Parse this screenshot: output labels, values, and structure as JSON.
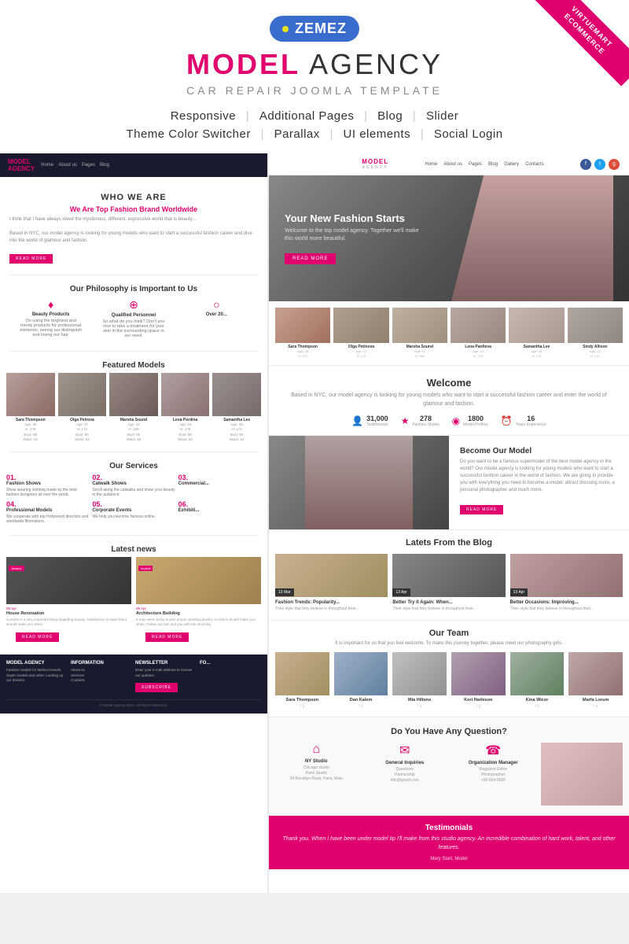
{
  "brand": {
    "logo": "ZEMEZ",
    "logo_dot_color": "#e8e020",
    "logo_bg": "#3a6cce"
  },
  "header": {
    "title_highlight": "MODEL",
    "title_rest": " AGENCY",
    "subtitle": "CAR REPAIR  JOOMLA TEMPLATE"
  },
  "features": {
    "row1": [
      "Responsive",
      "Additional Pages",
      "Blog",
      "Slider"
    ],
    "row2": [
      "Theme Color Switcher",
      "Parallax",
      "UI elements",
      "Social Login"
    ]
  },
  "ribbon": {
    "line1": "VIRTUEMART",
    "line2": "ECOMMERCE"
  },
  "left_panel": {
    "nav": {
      "logo": "MODEL AGENCY",
      "items": [
        "Home",
        "About us",
        "Pages",
        "Blog"
      ]
    },
    "who_we_are": {
      "heading": "WHO WE ARE",
      "subheading": "We Are Top Fashion Brand Worldwide",
      "text": "I think that I have always loved the mysterious, different, expressive world that is beauty...",
      "btn": "READ MORE"
    },
    "philosophy": {
      "title": "Our Philosophy is Important to Us",
      "items": [
        {
          "icon": "♦",
          "label": "Beauty Products",
          "text": "On using the brightest and trendy products for professional elements, seeing our distinguish and loving our hair."
        },
        {
          "icon": "⊕",
          "label": "Qualified Personnel",
          "text": "So what do you think? Don't you nice to take a treatment for your skin in the surrounding space in our need."
        },
        {
          "icon": "○",
          "label": "Over 20...",
          "text": ""
        }
      ]
    },
    "models": {
      "title": "Featured Models",
      "list": [
        {
          "name": "Sara Thompson",
          "details": "Age: 25\nHeight: 170\nBust: 88\nWaist: 61"
        },
        {
          "name": "Olga Petrova",
          "details": "Age: 27\nHeight: 172\nBust: 90\nWaist: 63"
        },
        {
          "name": "Marsha Sound",
          "details": "Age: 22\nHeight: 168\nBust: 86\nWaist: 60"
        },
        {
          "name": "Lena Perdina",
          "details": "Age: 24\nHeight: 170\nBust: 88\nWaist: 62"
        },
        {
          "name": "Samantha Lee",
          "details": "Age: 26\nHeight: 174\nBust: 92\nWaist: 64"
        }
      ]
    },
    "services": {
      "title": "Our Services",
      "list": [
        {
          "num": "01.",
          "name": "Fashion Shows",
          "text": "Show wearing clothing made by the best fashion designers all over the world."
        },
        {
          "num": "02.",
          "name": "Catwalk Shows",
          "text": "Scroll along the catwalks and show your beauty to the audience."
        },
        {
          "num": "03.",
          "name": "Commercial...",
          "text": ""
        },
        {
          "num": "04.",
          "name": "Professional Models",
          "text": "We cooperate with top Hollywood directors and other worldwide famous filmmakers."
        },
        {
          "num": "05.",
          "name": "Corporate Events",
          "text": "We help you become famous online."
        },
        {
          "num": "06.",
          "name": "Exhibiti...",
          "text": ""
        }
      ]
    },
    "news": {
      "title": "Latest news",
      "items": [
        {
          "badge": "Jewelry",
          "date": "05 Apr",
          "headline": "House Renovation",
          "text": "Comfort is a very important thing regarding beauty. Satisfaction is clear..."
        },
        {
          "badge": "Implicit",
          "date": "08 Apr",
          "headline": "Architecture Building",
          "text": "It may seem tricky to pick proper wedding jewelry so that it should make you shine. Follow our tips..."
        }
      ]
    },
    "footer": {
      "cols": [
        {
          "title": "MODEL AGENCY",
          "items": [
            "Fashion models for fashion brands. Super models and other. Looking up our dreams. Designers meet their."
          ]
        },
        {
          "title": "INFORMATION",
          "items": [
            "About us",
            "Services",
            "Contacts"
          ]
        },
        {
          "title": "NEWSLETTER",
          "items": [
            "Enter your e-mail address to receive our updates.",
            "SUBSCRIBE"
          ]
        },
        {
          "title": "FO...",
          "items": []
        }
      ],
      "bottom": "© Model Agency 2016. All Rights Reserved."
    }
  },
  "right_panel": {
    "nav": {
      "logo_main": "MODEL",
      "logo_sub": "AGENCY",
      "items": [
        "Home",
        "About us",
        "Pages",
        "Blog",
        "Gallery",
        "Contacts"
      ],
      "social": [
        "f",
        "t",
        "g+"
      ]
    },
    "hero": {
      "title": "Your New Fashion Starts",
      "subtitle": "Welcome to the top model agency. Together we'll make this world more beautiful.",
      "btn": "READ MORE"
    },
    "models": [
      {
        "name": "Sara Thompson",
        "info": "Age: 25\nH: 170"
      },
      {
        "name": "Olga Petinova",
        "info": "Age: 27\nH: 172"
      },
      {
        "name": "Marsha Sound",
        "info": "Age: 22\nH: 168"
      },
      {
        "name": "Lena Panfieva",
        "info": "Age: 24\nH: 170"
      },
      {
        "name": "Samantha Lee",
        "info": "Age: 26\nH: 174"
      },
      {
        "name": "Sindy Allison",
        "info": "Age: 23\nH: 171"
      }
    ],
    "welcome": {
      "title": "Welcome",
      "text": "Based in NYC, our model agency is looking for young models who want to start a successful fashion career and enter the world of glamour and fashion.",
      "stats": [
        {
          "icon": "👤",
          "num": "31,000",
          "label": "Testimonials"
        },
        {
          "icon": "★",
          "num": "278",
          "label": "Fashion Shows"
        },
        {
          "icon": "◉",
          "num": "1800",
          "label": "Model Profiles"
        },
        {
          "icon": "⏰",
          "num": "16",
          "label": "Years Experience"
        }
      ]
    },
    "become": {
      "title": "Become Our Model",
      "text": "Do you want to be a famous supermodel of the best model agency in the world? Our model agency is looking for young models who want to start a successful fashion career in the world of fashion. We are going to provide you with everything you need to become a model: attract dressing room, a personal photographer and much more.",
      "btn": "READ MORE"
    },
    "blog": {
      "title": "Latets From the Blog",
      "items": [
        {
          "date": "13",
          "month": "Mar",
          "headline": "Fashion Trends: Popularity...",
          "text": "Their style that they believe in..."
        },
        {
          "date": "13",
          "month": "Apr",
          "headline": "Better Try it Again: When...",
          "text": "Their style that they believe in..."
        },
        {
          "date": "13",
          "month": "Apr",
          "headline": "Better Occasions: Improving...",
          "text": "Their style that they believe in..."
        }
      ]
    },
    "team": {
      "title": "Our Team",
      "subtitle": "It is important for us that you feel welcome. To make this journey together, please meet our photography girls.",
      "members": [
        {
          "name": "Sara Thompson",
          "role": "f g"
        },
        {
          "name": "Dan Kalem",
          "role": "f g"
        },
        {
          "name": "Mia Hiltons",
          "role": "f g"
        },
        {
          "name": "Kori Harbison",
          "role": "f g"
        },
        {
          "name": "Kina Wicor",
          "role": "f g"
        },
        {
          "name": "Marfa Lorum",
          "role": "f g"
        }
      ]
    },
    "question": {
      "title": "Do You Have Any Question?",
      "items": [
        {
          "icon": "⌂",
          "label": "NY Studio",
          "text": "Chicago studio\nParis Studio\n34 Brooklyn Road, Paris, Main"
        },
        {
          "icon": "✉",
          "label": "General Inquiries",
          "text": "Questions\nPartnership\ninfo@gmail.com"
        },
        {
          "icon": "☎",
          "label": "Organization Manager",
          "text": "Magazine Editor\nPhotographer\n+38-054-5665"
        },
        {
          "label": "Woman photo",
          "isImage": true
        }
      ]
    },
    "testimonials": {
      "quote": "Thank you. When I have been under model tip I'll make from this studio agency. An incredible combination of hard work, talent, and other features.",
      "author": "Mary Start, Model"
    }
  }
}
